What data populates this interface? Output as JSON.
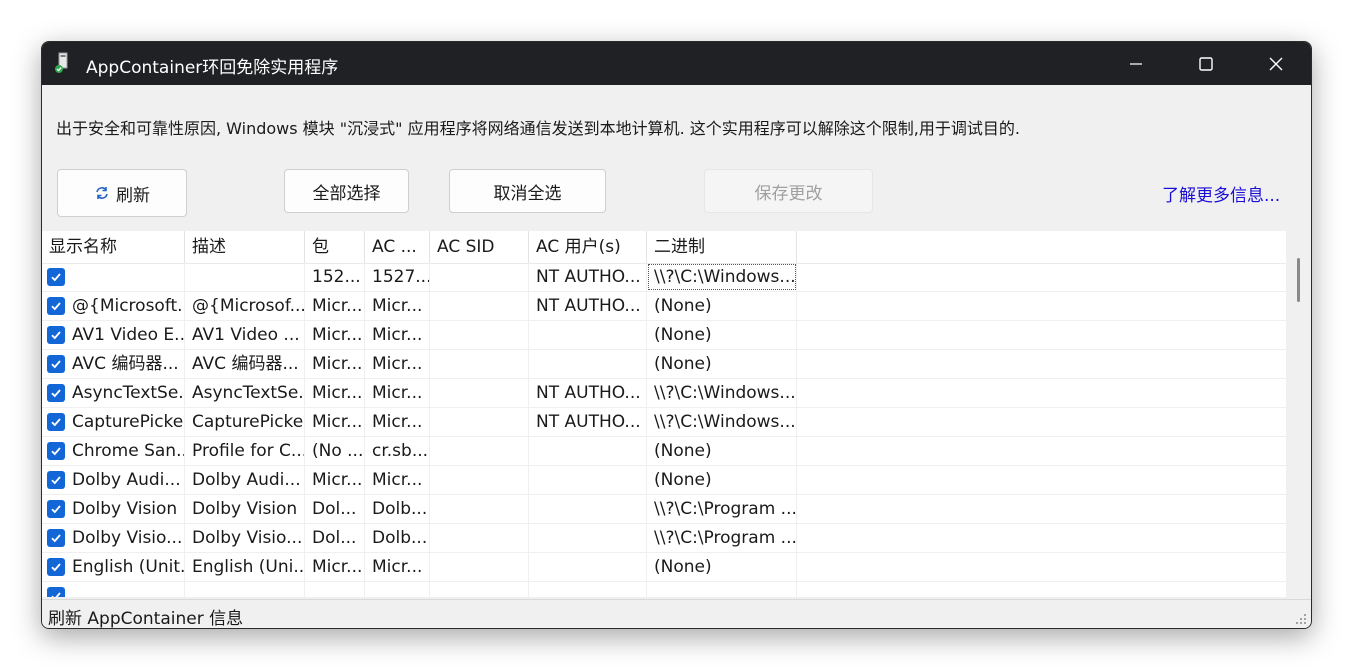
{
  "window": {
    "title": "AppContainer环回免除实用程序"
  },
  "description": "出于安全和可靠性原因, Windows 模块 \"沉浸式\" 应用程序将网络通信发送到本地计算机. 这个实用程序可以解除这个限制,用于调试目的.",
  "toolbar": {
    "refresh_label": "刷新",
    "select_all_label": "全部选择",
    "deselect_all_label": "取消全选",
    "save_label": "保存更改",
    "learn_more_label": "了解更多信息..."
  },
  "columns": [
    "显示名称",
    "描述",
    "包",
    "AC ...",
    "AC SID",
    "AC 用户(s)",
    "二进制",
    ""
  ],
  "rows": [
    {
      "checked": true,
      "name": "",
      "desc": "",
      "pkg": "152...",
      "ac": "1527...",
      "sid": "",
      "users": "NT AUTHO...",
      "binary": "\\\\?\\C:\\Windows..."
    },
    {
      "checked": true,
      "name": "@{Microsoft...",
      "desc": "@{Microsof...",
      "pkg": "Micr...",
      "ac": "Micr...",
      "sid": "",
      "users": "NT AUTHO...",
      "binary": "(None)"
    },
    {
      "checked": true,
      "name": "AV1 Video E...",
      "desc": "AV1 Video ...",
      "pkg": "Micr...",
      "ac": "Micr...",
      "sid": "",
      "users": "",
      "binary": "(None)"
    },
    {
      "checked": true,
      "name": "AVC 编码器...",
      "desc": "AVC 编码器...",
      "pkg": "Micr...",
      "ac": "Micr...",
      "sid": "",
      "users": "",
      "binary": "(None)"
    },
    {
      "checked": true,
      "name": "AsyncTextSe...",
      "desc": "AsyncTextSe...",
      "pkg": "Micr...",
      "ac": "Micr...",
      "sid": "",
      "users": "NT AUTHO...",
      "binary": "\\\\?\\C:\\Windows..."
    },
    {
      "checked": true,
      "name": "CapturePicker",
      "desc": "CapturePicker",
      "pkg": "Micr...",
      "ac": "Micr...",
      "sid": "",
      "users": "NT AUTHO...",
      "binary": "\\\\?\\C:\\Windows..."
    },
    {
      "checked": true,
      "name": "Chrome San...",
      "desc": "Profile for C...",
      "pkg": "(No ...",
      "ac": "cr.sb....",
      "sid": "",
      "users": "",
      "binary": "(None)"
    },
    {
      "checked": true,
      "name": "Dolby Audi...",
      "desc": "Dolby Audi...",
      "pkg": "Micr...",
      "ac": "Micr...",
      "sid": "",
      "users": "",
      "binary": "(None)"
    },
    {
      "checked": true,
      "name": "Dolby Vision",
      "desc": "Dolby Vision",
      "pkg": "Dol...",
      "ac": "Dolb...",
      "sid": "",
      "users": "",
      "binary": "\\\\?\\C:\\Program ..."
    },
    {
      "checked": true,
      "name": "Dolby Visio...",
      "desc": "Dolby Visio...",
      "pkg": "Dol...",
      "ac": "Dolb...",
      "sid": "",
      "users": "",
      "binary": "\\\\?\\C:\\Program ..."
    },
    {
      "checked": true,
      "name": "English (Unit...",
      "desc": "English (Uni...",
      "pkg": "Micr...",
      "ac": "Micr...",
      "sid": "",
      "users": "",
      "binary": "(None)"
    },
    {
      "checked": true,
      "name": "",
      "desc": "",
      "pkg": "",
      "ac": "",
      "sid": "",
      "users": "",
      "binary": ""
    }
  ],
  "status": "刷新 AppContainer 信息",
  "colors": {
    "titlebar": "#1f2125",
    "checkbox": "#1266d6",
    "link": "#1a0dd6"
  },
  "icons": [
    "app-icon",
    "refresh-icon",
    "minimize-icon",
    "maximize-icon",
    "close-icon",
    "checkbox-checked-icon",
    "resize-grip-icon"
  ]
}
